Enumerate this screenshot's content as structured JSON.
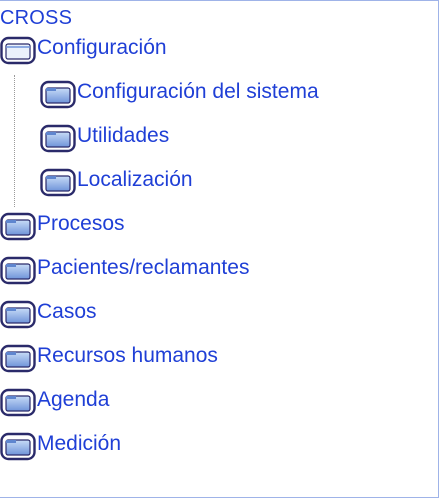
{
  "tree": {
    "root_label": "CROSS",
    "configuracion": {
      "label": "Configuración",
      "children": [
        {
          "label": "Configuración del sistema"
        },
        {
          "label": "Utilidades"
        },
        {
          "label": "Localización"
        }
      ]
    },
    "items": [
      {
        "label": "Procesos"
      },
      {
        "label": "Pacientes/reclamantes"
      },
      {
        "label": "Casos"
      },
      {
        "label": "Recursos humanos"
      },
      {
        "label": "Agenda"
      },
      {
        "label": "Medición"
      }
    ]
  },
  "icons": {
    "open_folder": "folder-open-icon",
    "closed_folder": "folder-icon"
  },
  "colors": {
    "link_text": "#1f3fd6",
    "folder_border": "#2a2a6a",
    "folder_fill": "#8fb0e6",
    "frame_border": "#9fb3e8"
  }
}
